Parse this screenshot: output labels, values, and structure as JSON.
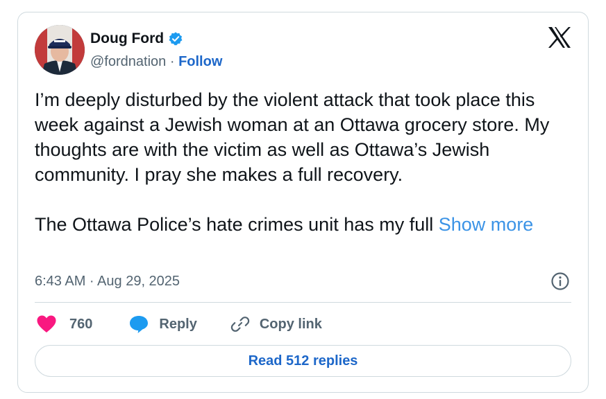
{
  "author": {
    "name": "Doug Ford",
    "handle": "@fordnation",
    "separator": "·",
    "follow_label": "Follow",
    "verified_color": "#1d9bf0"
  },
  "tweet": {
    "paragraph_1": "I’m deeply disturbed by the violent attack that took place this week against a Jewish woman at an Ottawa grocery store. My thoughts are with the victim as well as Ottawa’s Jewish community. I pray she makes a full recovery.",
    "paragraph_2": "The Ottawa Police’s hate crimes unit has my full",
    "show_more_label": "Show more",
    "timestamp": "6:43 AM · Aug 29, 2025"
  },
  "actions": {
    "like_count": "760",
    "reply_label": "Reply",
    "copy_link_label": "Copy link"
  },
  "footer": {
    "read_replies_label": "Read 512 replies"
  },
  "icons": {
    "logo": "x-logo-icon",
    "info": "info-icon",
    "like": "heart-icon",
    "reply": "speech-bubble-icon",
    "copy": "link-icon",
    "verified": "verified-badge-icon"
  },
  "colors": {
    "heart": "#f91880",
    "reply_bubble": "#1d9bf0",
    "link_blue": "#1d67c9",
    "show_more": "#3b93e6",
    "muted": "#536471"
  }
}
